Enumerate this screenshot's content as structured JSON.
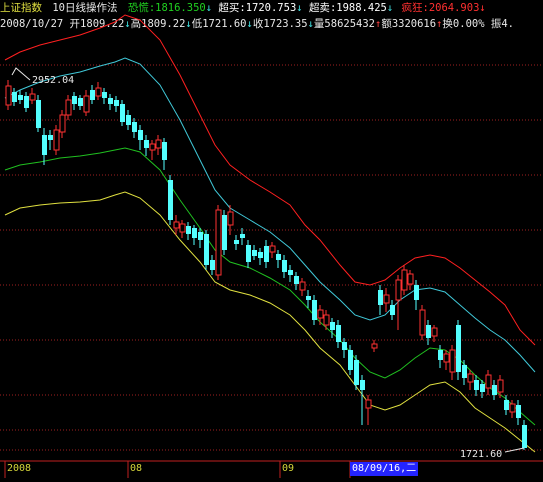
{
  "header_line1": {
    "index_name": "上证指数",
    "indicator": "10日线操作法",
    "panic_label": "恐慌",
    "panic_value": ":1816.350",
    "panic_arrow": "↓",
    "oversold_label": "超买",
    "oversold_value": ":1720.753",
    "oversold_arrow": "↓",
    "overbought_label": "超卖",
    "overbought_value": ":1988.425",
    "overbought_arrow": "↓",
    "crazy_label": "疯狂",
    "crazy_value": ":2064.903",
    "crazy_arrow": "↓"
  },
  "header_line2": {
    "date": "2008/10/27",
    "open_label": "开",
    "open_value": "1809.22",
    "open_arrow": "↓",
    "high_label": "高",
    "high_value": "1809.22",
    "high_arrow": "↓",
    "low_label": "低",
    "low_value": "1721.60",
    "low_arrow": "↓",
    "close_label": "收",
    "close_value": "1723.35",
    "close_arrow": "↓",
    "volume_label": "量",
    "volume_value": "58625432",
    "volume_arrow": "↑",
    "amount_label": "额",
    "amount_value": "3320616",
    "amount_arrow": "↑",
    "turnover_label": "换",
    "turnover_value": "0.00%",
    "amplitude_label": "振",
    "amplitude_value": "4."
  },
  "annotations": {
    "high_marker": "2952.04",
    "low_marker": "1721.60"
  },
  "x_axis": {
    "labels": [
      "2008",
      "08",
      "09"
    ],
    "cursor_label": "08/09/16,二"
  },
  "colors": {
    "up_candle": "#ff3232",
    "down_candle": "#54ffff",
    "band_red": "#ff2020",
    "band_cyan": "#40c8d8",
    "band_green": "#20c020",
    "band_yellow": "#e0e040",
    "grid": "#a02020",
    "panic": "#20d020",
    "oversold": "#ffffff",
    "overbought": "#ffffff",
    "crazy": "#ff3030",
    "info_text": "#e8e8e8",
    "arrow_down": "#40e0e0",
    "arrow_up": "#ff4040"
  }
}
